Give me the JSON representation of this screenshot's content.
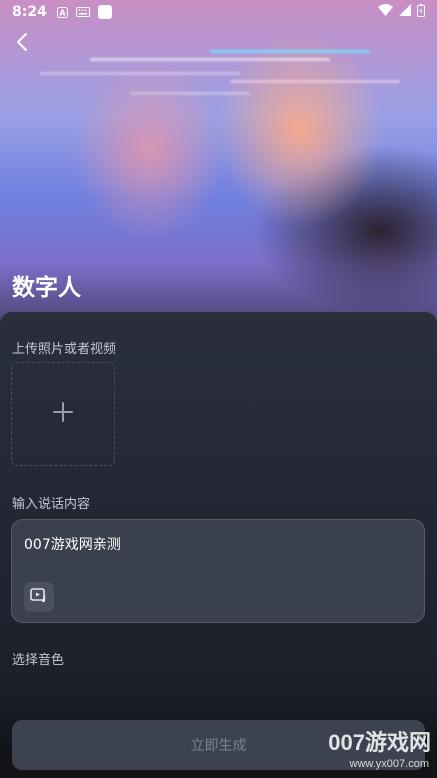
{
  "status_bar": {
    "time": "8:24",
    "icons": [
      "a-badge-icon",
      "keyboard-icon",
      "app-square-icon",
      "wifi-icon",
      "signal-icon",
      "battery-icon"
    ]
  },
  "header": {
    "back_icon": "chevron-left-icon",
    "title": "数字人"
  },
  "upload": {
    "label": "上传照片或者视频",
    "icon": "plus-icon"
  },
  "speech": {
    "label": "输入说话内容",
    "value": "007游戏网亲测",
    "media_icon": "video-music-icon"
  },
  "voice": {
    "label": "选择音色"
  },
  "action": {
    "generate_label": "立即生成"
  },
  "watermark": {
    "brand": "007游戏网",
    "url": "www.yx007.com"
  },
  "colors": {
    "panel_bg": "#2a2f3c",
    "input_bg": "#3b404f",
    "button_bg": "#3d4250",
    "button_text": "#7d8292",
    "accent_cyan": "#6fe3ff"
  }
}
